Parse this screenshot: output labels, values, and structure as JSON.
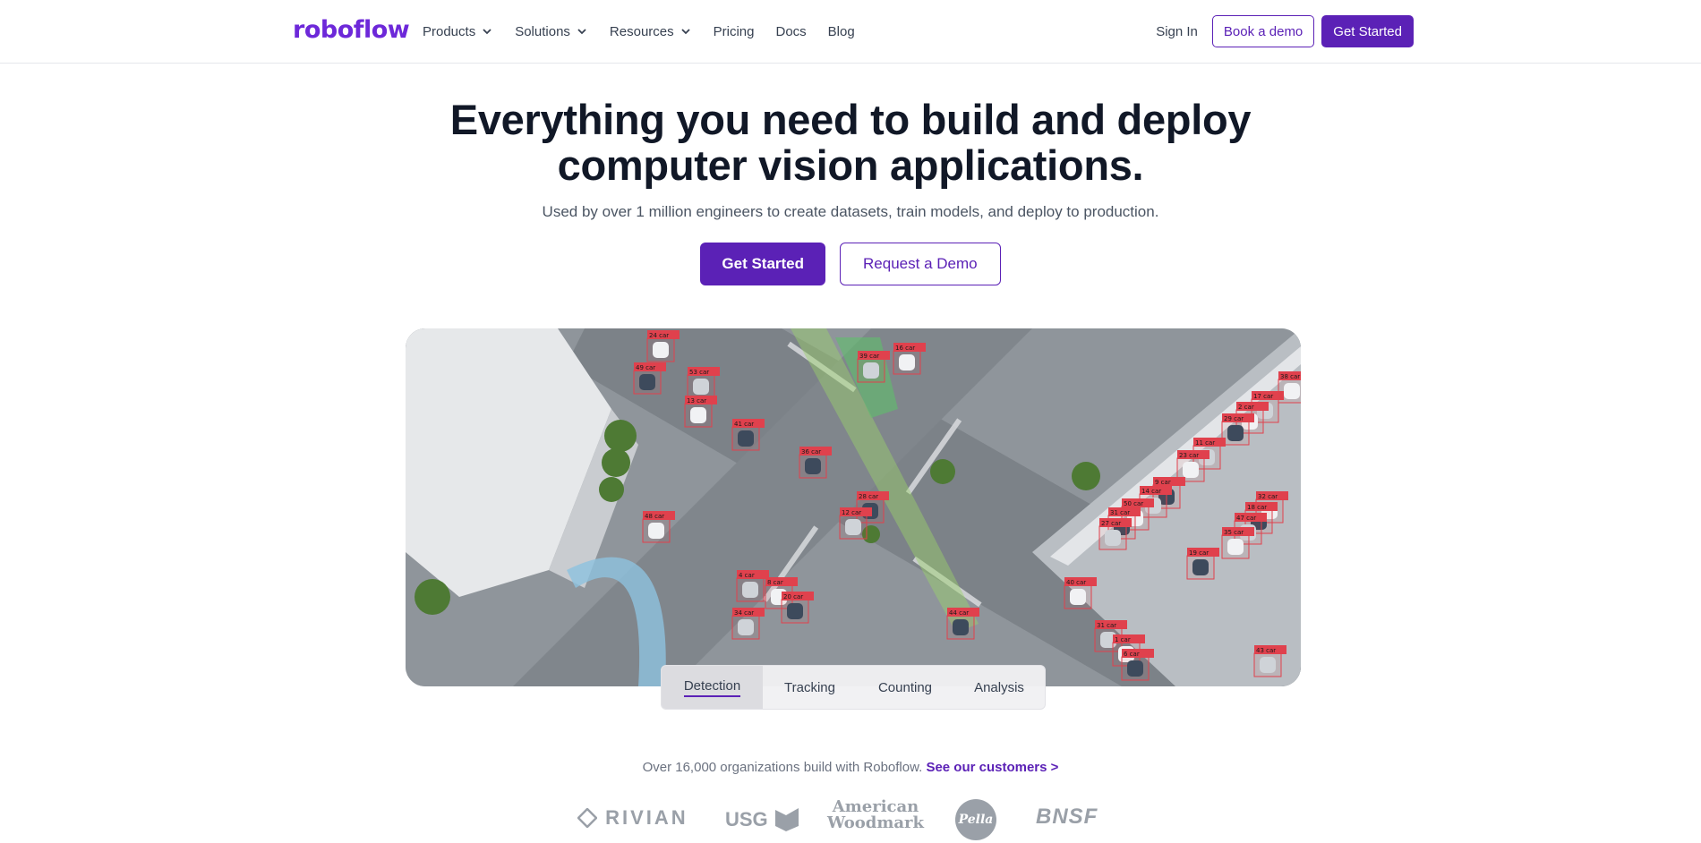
{
  "brand": {
    "logo_text": "roboflow",
    "accent": "#5b21b6"
  },
  "nav": {
    "items": [
      {
        "label": "Products",
        "dropdown": true
      },
      {
        "label": "Solutions",
        "dropdown": true
      },
      {
        "label": "Resources",
        "dropdown": true
      },
      {
        "label": "Pricing",
        "dropdown": false
      },
      {
        "label": "Docs",
        "dropdown": false
      },
      {
        "label": "Blog",
        "dropdown": false
      }
    ],
    "sign_in": "Sign In",
    "book_demo": "Book a demo",
    "get_started": "Get Started"
  },
  "hero": {
    "title_line1": "Everything you need to build and deploy",
    "title_line2": "computer vision applications.",
    "subtitle": "Used by over 1 million engineers to create datasets, train models, and deploy to production.",
    "primary_cta": "Get Started",
    "secondary_cta": "Request a Demo"
  },
  "video": {
    "detection_labels": [
      "24 car",
      "49 car",
      "53 car",
      "13 car",
      "41 car",
      "39 car",
      "16 car",
      "36 car",
      "17 car",
      "2 car",
      "29 car",
      "11 car",
      "23 car",
      "28 car",
      "12 car",
      "48 car",
      "9 car",
      "14 car",
      "50 car",
      "31 car",
      "27 car",
      "32 car",
      "18 car",
      "47 car",
      "35 car",
      "19 car",
      "4 car",
      "8 car",
      "20 car",
      "34 car",
      "40 car",
      "44 car",
      "31 car",
      "1 car",
      "6 car",
      "43 car",
      "38 car"
    ],
    "tabs": [
      "Detection",
      "Tracking",
      "Counting",
      "Analysis"
    ],
    "active_tab": "Detection"
  },
  "customers": {
    "text": "Over 16,000 organizations build with Roboflow.",
    "link": "See our customers >",
    "logos": [
      "RIVIAN",
      "USG",
      "American Woodmark",
      "Pella",
      "BNSF"
    ]
  }
}
